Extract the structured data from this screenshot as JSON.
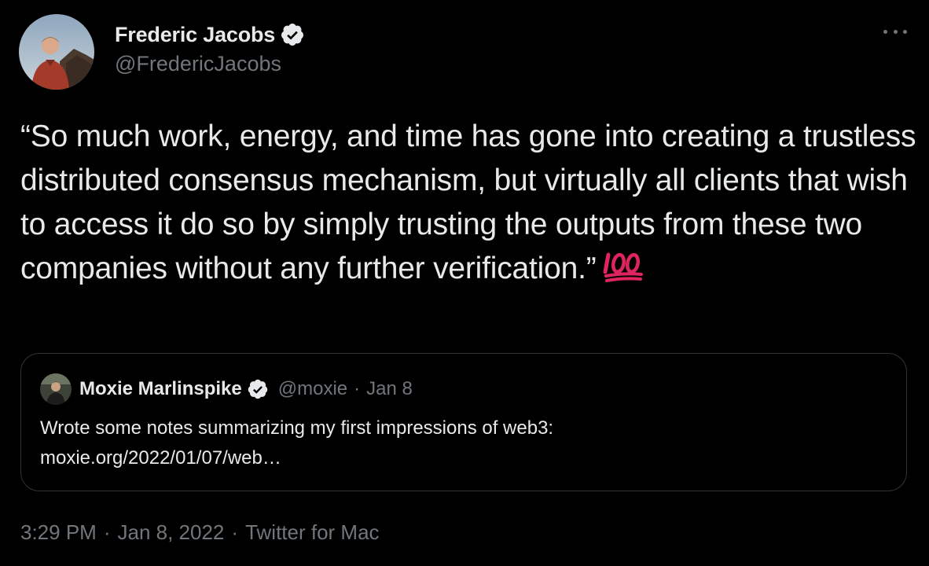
{
  "author": {
    "display_name": "Frederic Jacobs",
    "handle": "@FredericJacobs",
    "verified": true
  },
  "more_icon": "more-horizontal-icon",
  "tweet": {
    "text": "“So much work, energy, and time has gone into creating a trustless distributed consensus mechanism, but virtually all clients that wish to access it do so by simply trusting the outputs from these two companies without any further verification.”",
    "emoji": "hundred-points-emoji"
  },
  "quoted_tweet": {
    "display_name": "Moxie Marlinspike",
    "handle": "@moxie",
    "separator": "·",
    "date": "Jan 8",
    "text_line1": "Wrote some notes summarizing my first impressions of web3:",
    "link": "moxie.org/2022/01/07/web…",
    "verified": true
  },
  "metadata": {
    "time": "3:29 PM",
    "separator": "·",
    "date": "Jan 8, 2022",
    "source": "Twitter for Mac"
  },
  "colors": {
    "background": "#000000",
    "primary_text": "#e7e9ea",
    "secondary_text": "#71767b",
    "border": "#2f3336",
    "emoji_red": "#e0245e"
  }
}
